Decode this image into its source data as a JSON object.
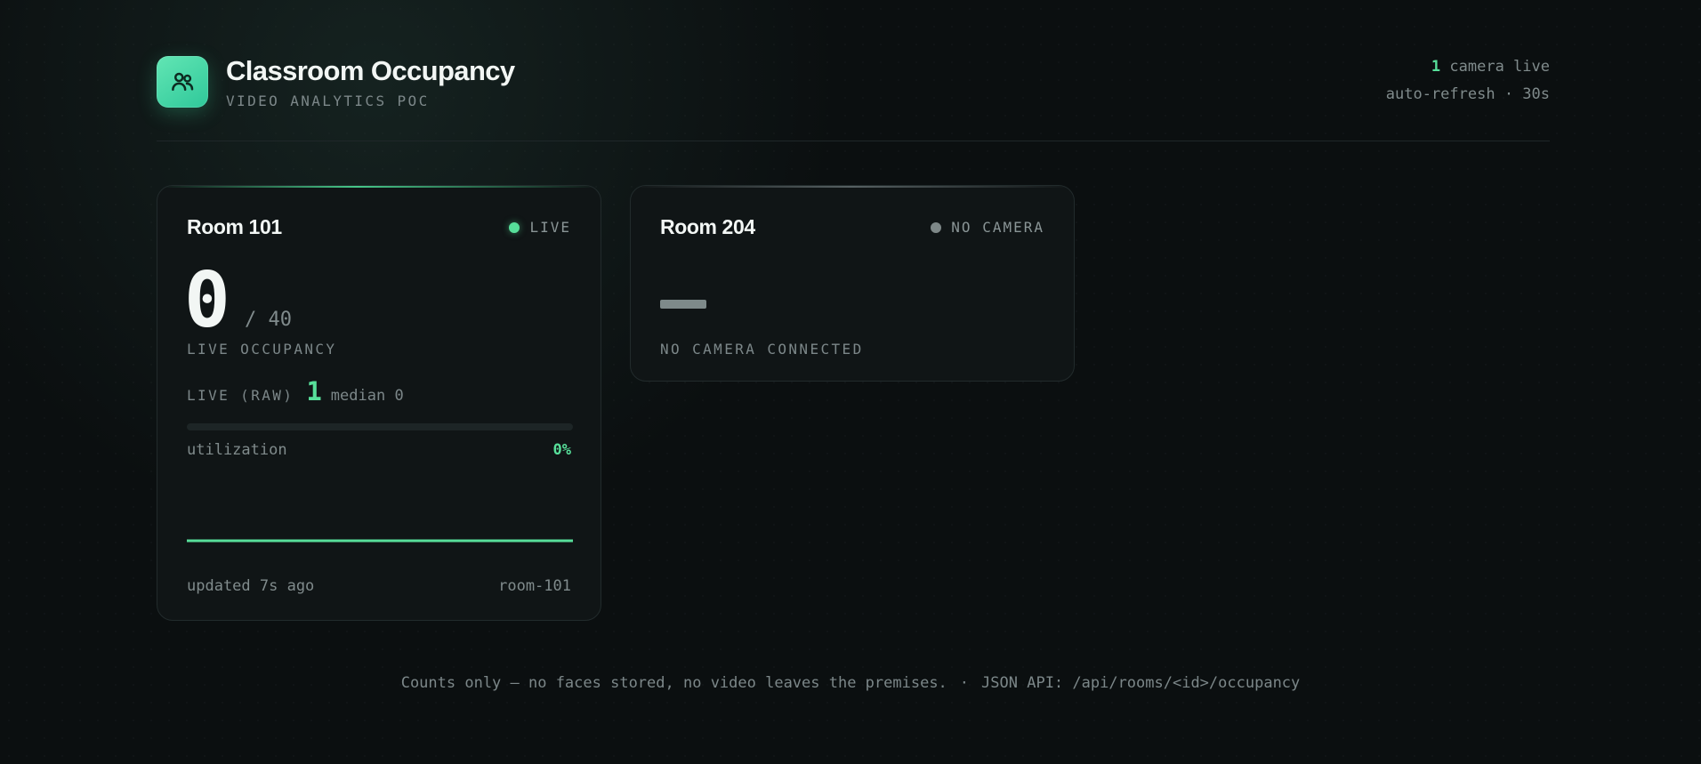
{
  "header": {
    "title": "Classroom Occupancy",
    "subtitle": "VIDEO ANALYTICS POC",
    "logo_icon": "people-icon",
    "cameras_live_count": "1",
    "cameras_live_label": " camera live",
    "refresh_label": "auto-refresh · 30s"
  },
  "rooms": [
    {
      "name": "Room 101",
      "status": "LIVE",
      "status_color": "#57df9a",
      "occupancy": "0",
      "capacity": "/ 40",
      "occupancy_label": "LIVE OCCUPANCY",
      "raw_label": "LIVE (RAW)",
      "raw_value": "1",
      "median_label": "median 0",
      "utilization_label": "utilization",
      "utilization_value": "0%",
      "utilization_fraction": 0,
      "updated": "updated 7s ago",
      "room_id": "room-101"
    },
    {
      "name": "Room 204",
      "status": "NO CAMERA",
      "status_color": "#7e8888",
      "placeholder_label": "NO CAMERA CONNECTED"
    }
  ],
  "footer": {
    "privacy_note": "Counts only — no faces stored, no video leaves the premises.",
    "separator": "·",
    "api_note": "JSON API: /api/rooms/<id>/occupancy"
  },
  "colors": {
    "accent": "#57df9a",
    "background": "#0b0f10",
    "card": "#101516"
  }
}
